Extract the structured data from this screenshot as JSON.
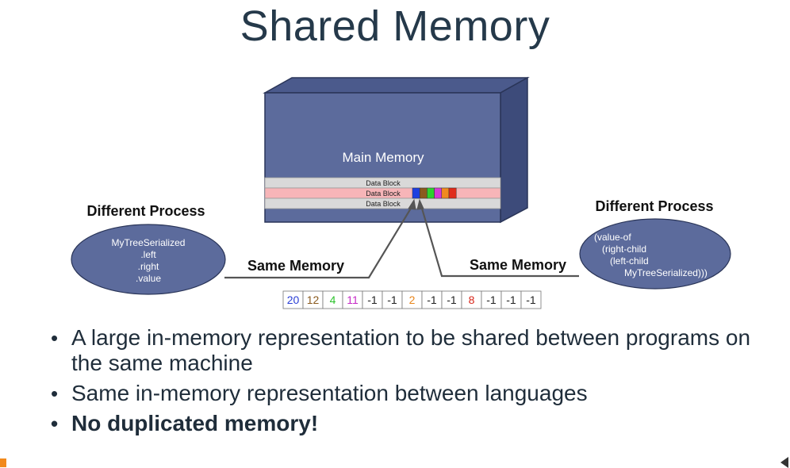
{
  "title": "Shared Memory",
  "main_memory_label": "Main Memory",
  "data_blocks": [
    "Data Block",
    "Data Block",
    "Data Block"
  ],
  "block_colors": [
    "#1f3fe0",
    "#8a5a1e",
    "#2ed12e",
    "#d63ad6",
    "#f08a1f",
    "#e02a1a"
  ],
  "left_process": {
    "heading": "Different Process",
    "lines": [
      "MyTreeSerialized",
      ".left",
      ".right",
      ".value"
    ]
  },
  "right_process": {
    "heading": "Different Process",
    "lines": [
      "(value-of",
      "(right-child",
      "(left-child",
      "MyTreeSerialized)))"
    ]
  },
  "same_memory_left": "Same Memory",
  "same_memory_right": "Same Memory",
  "array_cells": [
    {
      "value": "20",
      "color": "#2a3fd6"
    },
    {
      "value": "12",
      "color": "#8a5a1e"
    },
    {
      "value": "4",
      "color": "#2ec22e"
    },
    {
      "value": "11",
      "color": "#c62ac6"
    },
    {
      "value": "-1",
      "color": "#222222"
    },
    {
      "value": "-1",
      "color": "#222222"
    },
    {
      "value": "2",
      "color": "#e8861c"
    },
    {
      "value": "-1",
      "color": "#222222"
    },
    {
      "value": "-1",
      "color": "#222222"
    },
    {
      "value": "8",
      "color": "#d8261a"
    },
    {
      "value": "-1",
      "color": "#222222"
    },
    {
      "value": "-1",
      "color": "#222222"
    },
    {
      "value": "-1",
      "color": "#222222"
    }
  ],
  "bullets": [
    "A large in-memory representation to be shared between programs on the same machine",
    "Same in-memory representation between languages",
    "No duplicated memory!"
  ]
}
